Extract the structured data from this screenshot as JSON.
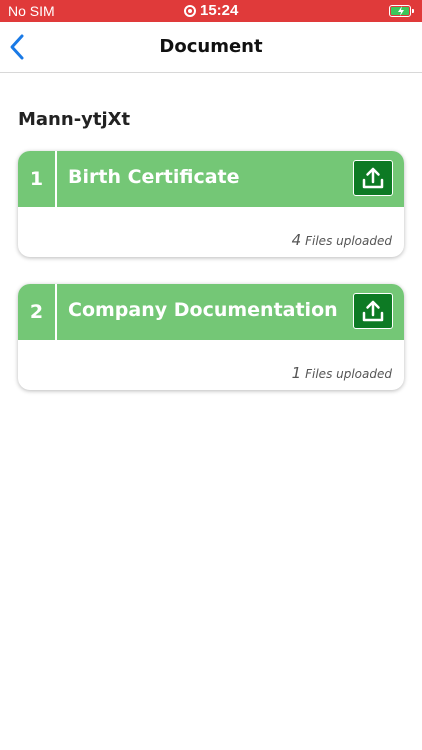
{
  "status_bar": {
    "carrier": "No SIM",
    "time": "15:24",
    "battery_color": "#3cc75a",
    "background_color": "#e03a3a"
  },
  "nav": {
    "title": "Document",
    "back_icon": "chevron-left-icon",
    "accent_color": "#1a7ae6"
  },
  "owner": {
    "name": "Mann-ytjXt"
  },
  "documents": [
    {
      "number": "1",
      "title": "Birth Certificate",
      "files_count": "4",
      "files_label": "Files uploaded",
      "upload_icon": "upload-icon"
    },
    {
      "number": "2",
      "title": "Company Documentation",
      "files_count": "1",
      "files_label": "Files uploaded",
      "upload_icon": "upload-icon"
    }
  ],
  "theme": {
    "card_header_color": "#74c776",
    "upload_button_color": "#0d7a24"
  }
}
